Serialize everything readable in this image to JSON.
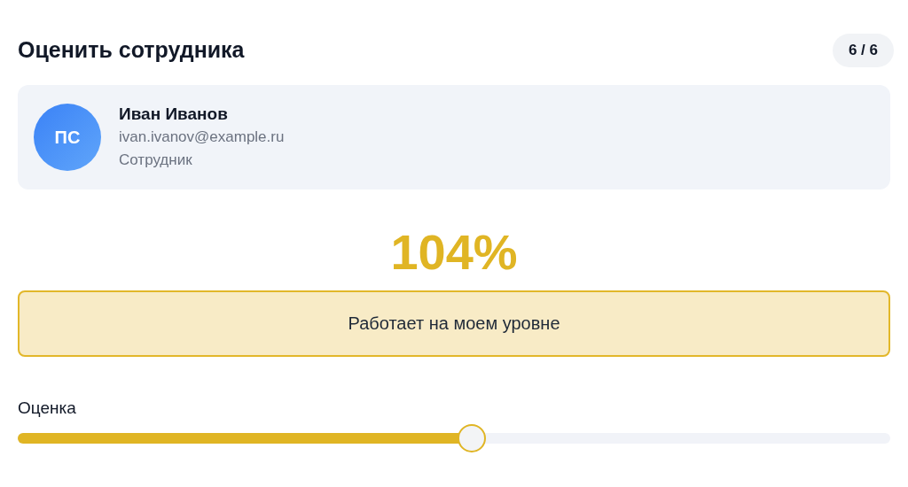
{
  "title": "Оценить сотрудника",
  "counter": "6 / 6",
  "employee": {
    "initials": "ПС",
    "name": "Иван Иванов",
    "email": "ivan.ivanov@example.ru",
    "role": "Сотрудник"
  },
  "score": {
    "percent": "104%",
    "verdict": "Работает на моем уровне"
  },
  "rating": {
    "label": "Оценка",
    "level": 0.52
  }
}
